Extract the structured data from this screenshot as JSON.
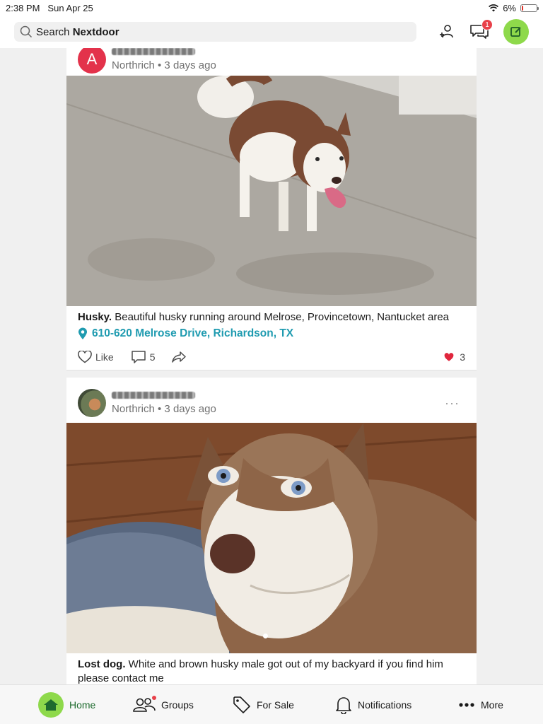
{
  "status": {
    "time": "2:38 PM",
    "date": "Sun Apr 25",
    "battery": "6%"
  },
  "header": {
    "search_placeholder_prefix": "Search ",
    "search_placeholder_brand": "Nextdoor",
    "messages_badge": "1"
  },
  "posts": [
    {
      "avatar_letter": "A",
      "neighborhood_time": "Northrich • 3 days ago",
      "text_bold": "Husky.",
      "text": " Beautiful husky running around Melrose, Provincetown, Nantucket area",
      "location": "610-620 Melrose Drive, Richardson, TX",
      "like_label": "Like",
      "comments": "5",
      "reactions": "3"
    },
    {
      "neighborhood_time": "Northrich • 3 days ago",
      "more": "···",
      "text_bold": "Lost dog.",
      "text": " White and brown husky male got out of my backyard if you find him please contact me"
    }
  ],
  "tabs": [
    {
      "label": "Home",
      "icon": "home-icon",
      "active": true
    },
    {
      "label": "Groups",
      "icon": "groups-icon"
    },
    {
      "label": "For Sale",
      "icon": "tag-icon"
    },
    {
      "label": "Notifications",
      "icon": "bell-icon"
    },
    {
      "label": "More",
      "icon": "more-dots-icon"
    }
  ],
  "colors": {
    "accent_green": "#8ed94b",
    "link_teal": "#1f9bb0",
    "badge_red": "#e8414a",
    "home_green": "#1e6b2e"
  }
}
